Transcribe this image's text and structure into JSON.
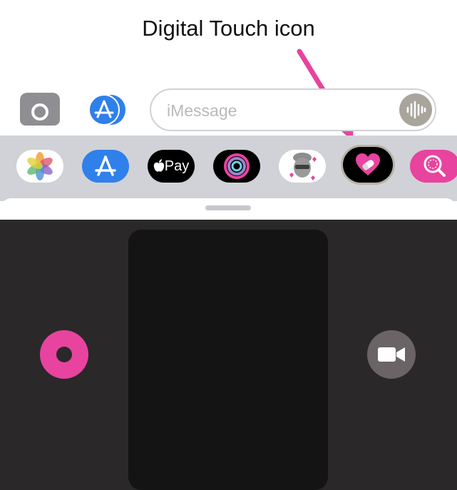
{
  "annotation": {
    "title": "Digital Touch icon",
    "arrow_color": "#e8439f"
  },
  "compose": {
    "camera_icon": "camera-icon",
    "appstore_icon": "app-store-icon",
    "placeholder": "iMessage",
    "voice_icon": "waveform-icon"
  },
  "app_strip": {
    "items": [
      {
        "name": "Photos",
        "icon": "photos-icon"
      },
      {
        "name": "App Store",
        "icon": "app-store-icon"
      },
      {
        "name": "Apple Pay",
        "label": "Pay",
        "icon": "apple-logo-icon"
      },
      {
        "name": "Activity",
        "icon": "activity-rings-icon"
      },
      {
        "name": "Memoji",
        "icon": "memoji-icon"
      },
      {
        "name": "Digital Touch",
        "icon": "heart-icon",
        "selected": true
      },
      {
        "name": "Images",
        "icon": "globe-search-icon"
      }
    ]
  },
  "digital_touch": {
    "color_button_color": "#e8439f",
    "video_icon": "video-camera-icon"
  }
}
